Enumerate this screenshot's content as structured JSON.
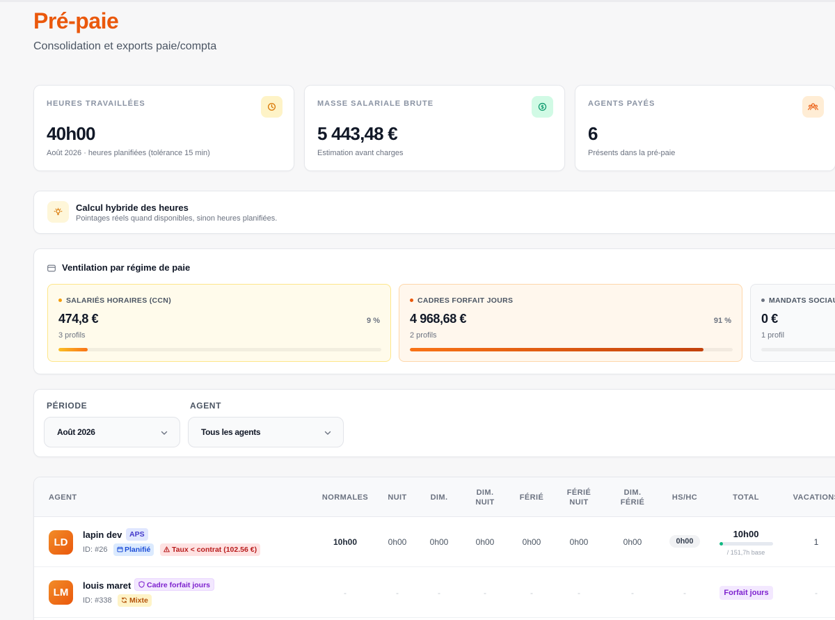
{
  "header": {
    "title": "Pré-paie",
    "subtitle": "Consolidation et exports paie/compta"
  },
  "stats": [
    {
      "label": "HEURES TRAVAILLÉES",
      "value": "40h00",
      "note": "Août 2026 · heures planifiées (tolérance 15 min)",
      "icon": "clock-icon",
      "color": "#d97706"
    },
    {
      "label": "MASSE SALARIALE BRUTE",
      "value": "5 443,48 €",
      "note": "Estimation avant charges",
      "icon": "dollar-icon",
      "color": "#059669"
    },
    {
      "label": "AGENTS PAYÉS",
      "value": "6",
      "note": "Présents dans la pré-paie",
      "icon": "users-icon",
      "color": "#ea580c"
    }
  ],
  "hybrid": {
    "title": "Calcul hybride des heures",
    "desc": "Pointages réels quand disponibles, sinon heures planifiées.",
    "icon": "lightbulb-icon"
  },
  "ventilation": {
    "title": "Ventilation par régime de paie",
    "icon": "card-icon",
    "regimes": [
      {
        "label": "SALARIÉS HORAIRES (CCN)",
        "value": "474,8 €",
        "pct": "9 %",
        "profiles": "3 profils",
        "fill": 0.09,
        "color": "#f59e0b"
      },
      {
        "label": "CADRES FORFAIT JOURS",
        "value": "4 968,68 €",
        "pct": "91 %",
        "profiles": "2 profils",
        "fill": 0.91,
        "color": "#ea580c"
      },
      {
        "label": "MANDATS SOCIAUX",
        "value": "0 €",
        "pct": "",
        "profiles": "1 profil",
        "fill": 0,
        "color": "#6b7280"
      }
    ]
  },
  "filters": {
    "period_label": "PÉRIODE",
    "period_value": "Août 2026",
    "agent_label": "AGENT",
    "agent_value": "Tous les agents"
  },
  "table": {
    "columns": [
      "AGENT",
      "NORMALES",
      "NUIT",
      "DIM.",
      "DIM. NUIT",
      "FÉRIÉ",
      "FÉRIÉ NUIT",
      "DIM. FÉRIÉ",
      "HS/HC",
      "TOTAL",
      "VACATIONS"
    ],
    "rows": [
      {
        "initials": "LD",
        "name": "lapin dev",
        "role_badge": "APS",
        "id": "ID: #26",
        "status_badge": "Planifié",
        "warning_badge": "Taux < contrat (102.56 €)",
        "normales": "10h00",
        "nuit": "0h00",
        "dim": "0h00",
        "dim_nuit": "0h00",
        "ferie": "0h00",
        "ferie_nuit": "0h00",
        "dim_ferie": "0h00",
        "hs_hc": "0h00",
        "total": "10h00",
        "total_base": "/ 151,7h base",
        "total_progress": 0.066,
        "vacations": "1"
      },
      {
        "initials": "LM",
        "name": "louis maret",
        "role_badge": "Cadre forfait jours",
        "id": "ID: #338",
        "mode_badge": "Mixte",
        "placeholder": "-",
        "total": "Forfait jours",
        "vacations": "-"
      }
    ]
  }
}
